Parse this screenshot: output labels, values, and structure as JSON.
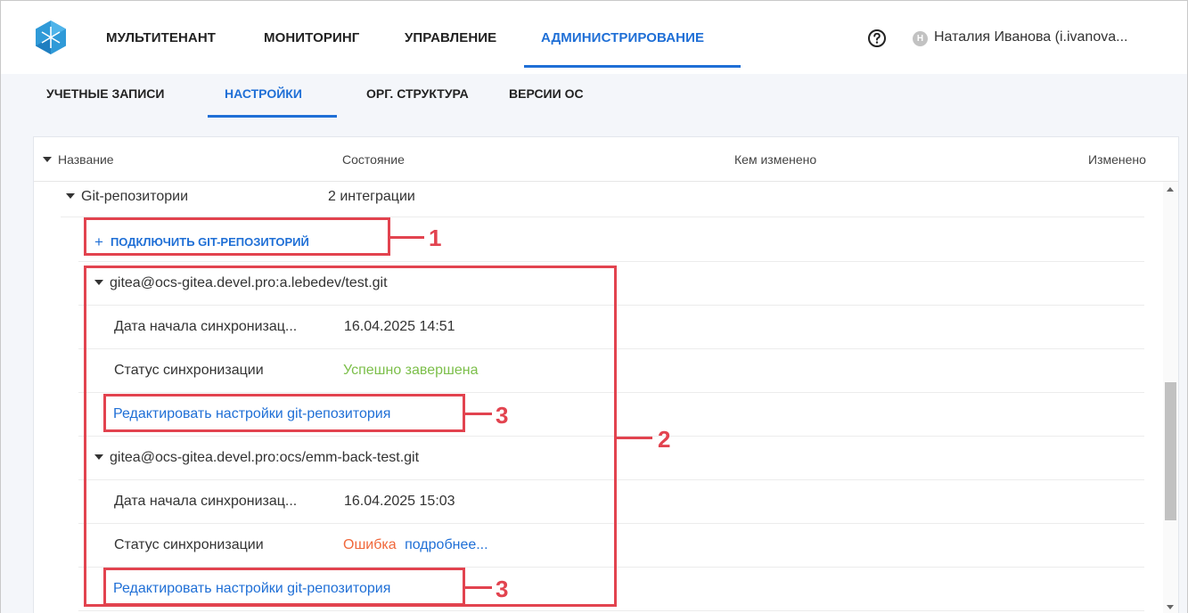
{
  "header": {
    "tabs": [
      {
        "label": "МУЛЬТИТЕНАНТ"
      },
      {
        "label": "МОНИТОРИНГ"
      },
      {
        "label": "УПРАВЛЕНИЕ"
      },
      {
        "label": "АДМИНИСТРИРОВАНИЕ",
        "active": true
      }
    ],
    "user_initial": "Н",
    "user_name": "Наталия Иванова (i.ivanova..."
  },
  "subnav": {
    "tabs": [
      {
        "label": "УЧЕТНЫЕ ЗАПИСИ"
      },
      {
        "label": "НАСТРОЙКИ",
        "active": true
      },
      {
        "label": "ОРГ. СТРУКТУРА"
      },
      {
        "label": "ВЕРСИИ ОС"
      }
    ]
  },
  "table": {
    "columns": [
      "Название",
      "Состояние",
      "Кем изменено",
      "Изменено"
    ],
    "group": {
      "name": "Git-репозитории",
      "status": "2 интеграции"
    },
    "add_button": "ПОДКЛЮЧИТЬ GIT-РЕПОЗИТОРИЙ",
    "add_icon": "plus-icon",
    "repos": [
      {
        "name": "gitea@ocs-gitea.devel.pro:a.lebedev/test.git",
        "sync_date_label": "Дата начала синхронизац...",
        "sync_date": "16.04.2025 14:51",
        "sync_status_label": "Статус синхронизации",
        "sync_status": "Успешно завершена",
        "edit_link": "Редактировать настройки git-репозитория"
      },
      {
        "name": "gitea@ocs-gitea.devel.pro:ocs/emm-back-test.git",
        "sync_date_label": "Дата начала синхронизац...",
        "sync_date": "16.04.2025 15:03",
        "sync_status_label": "Статус синхронизации",
        "sync_status": "Ошибка",
        "details_link": "подробнее...",
        "edit_link": "Редактировать настройки git-репозитория"
      }
    ]
  },
  "callouts": {
    "one": "1",
    "two": "2",
    "three_a": "3",
    "three_b": "3"
  },
  "colors": {
    "accent": "#1f6fd6",
    "success": "#7cbf4a",
    "error": "#f0683b",
    "annotation": "#e2434f"
  }
}
